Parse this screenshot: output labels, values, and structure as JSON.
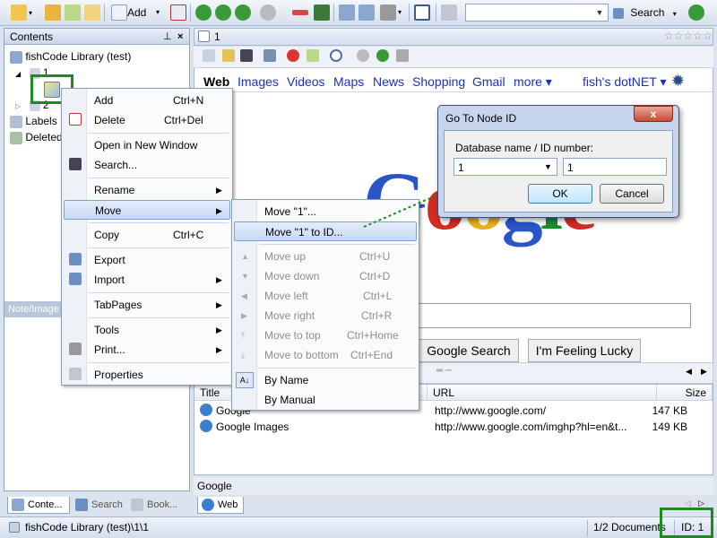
{
  "toolbar": {
    "add_label": "Add",
    "search_label": "Search",
    "search_value": ""
  },
  "left_pane": {
    "title": "Contents",
    "pin": "− x",
    "tree": [
      {
        "label": "fishCode Library (test)"
      },
      {
        "label": "1"
      },
      {
        "label": "2"
      },
      {
        "label": "Labels"
      },
      {
        "label": "Deleted"
      }
    ],
    "note_bar": "Note/Image"
  },
  "left_tabs": [
    {
      "label": "Conte..."
    },
    {
      "label": "Search"
    },
    {
      "label": "Book..."
    }
  ],
  "document_tab": {
    "label": "1",
    "stars": "☆☆☆☆☆"
  },
  "browser": {
    "gbar": [
      "Web",
      "Images",
      "Videos",
      "Maps",
      "News",
      "Shopping",
      "Gmail",
      "more ▾"
    ],
    "gbar_right": "fish's dotNET ▾",
    "logo": [
      "G",
      "o",
      "o",
      "g",
      "l",
      "e"
    ],
    "logo_colors": [
      "#2a55c9",
      "#d22b1f",
      "#e6b01a",
      "#2a55c9",
      "#1c8c2b",
      "#d22b1f"
    ],
    "btn_search": "Google Search",
    "btn_lucky": "I'm Feeling Lucky"
  },
  "list": {
    "columns": {
      "title": "Title",
      "url": "URL",
      "size": "Size"
    },
    "rows": [
      {
        "title": "Google",
        "url": "http://www.google.com/",
        "size": "147 KB"
      },
      {
        "title": "Google Images",
        "url": "http://www.google.com/imghp?hl=en&t...",
        "size": "149 KB"
      }
    ]
  },
  "status_label": "Google",
  "web_tab": "Web",
  "statusbar": {
    "path": "fishCode Library (test)\\1\\1",
    "docs": "1/2 Documents",
    "id": "ID: 1"
  },
  "context_menu": {
    "items": [
      {
        "label": "Add",
        "shortcut": "Ctrl+N"
      },
      {
        "label": "Delete",
        "shortcut": "Ctrl+Del"
      },
      {
        "label": "Open in New Window",
        "shortcut": ""
      },
      {
        "label": "Search...",
        "shortcut": ""
      },
      {
        "label": "Rename",
        "shortcut": ""
      },
      {
        "label": "Move",
        "shortcut": ""
      },
      {
        "label": "Copy",
        "shortcut": "Ctrl+C"
      },
      {
        "label": "Export",
        "shortcut": ""
      },
      {
        "label": "Import",
        "shortcut": ""
      },
      {
        "label": "TabPages",
        "shortcut": ""
      },
      {
        "label": "Tools",
        "shortcut": ""
      },
      {
        "label": "Print...",
        "shortcut": ""
      },
      {
        "label": "Properties",
        "shortcut": ""
      }
    ]
  },
  "move_menu": {
    "items": [
      {
        "label": "Move \"1\"...",
        "shortcut": ""
      },
      {
        "label": "Move \"1\" to ID...",
        "shortcut": ""
      },
      {
        "label": "Move up",
        "shortcut": "Ctrl+U"
      },
      {
        "label": "Move down",
        "shortcut": "Ctrl+D"
      },
      {
        "label": "Move left",
        "shortcut": "Ctrl+L"
      },
      {
        "label": "Move right",
        "shortcut": "Ctrl+R"
      },
      {
        "label": "Move to top",
        "shortcut": "Ctrl+Home"
      },
      {
        "label": "Move to bottom",
        "shortcut": "Ctrl+End"
      },
      {
        "label": "By Name",
        "shortcut": ""
      },
      {
        "label": "By Manual",
        "shortcut": ""
      }
    ]
  },
  "dialog": {
    "title": "Go To Node ID",
    "field_label": "Database name / ID number:",
    "db_value": "1",
    "id_value": "1",
    "ok": "OK",
    "cancel": "Cancel",
    "close": "x"
  }
}
